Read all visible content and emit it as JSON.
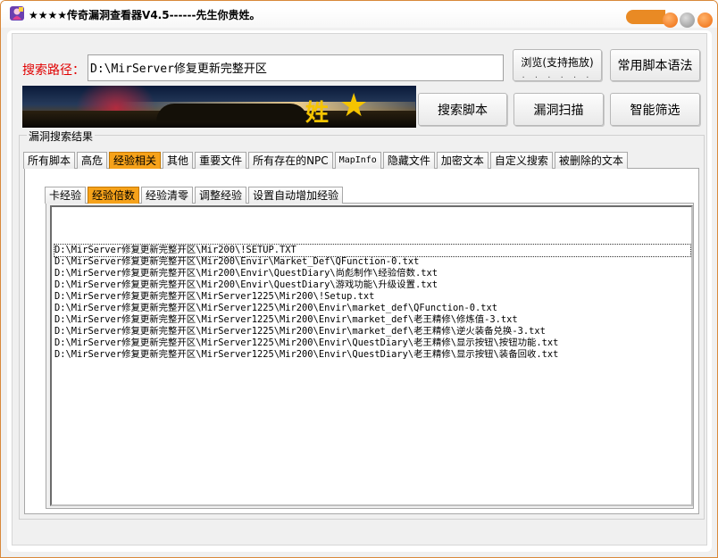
{
  "window": {
    "title": "★★★★传奇漏洞查看器V4.5------先生你贵姓。",
    "accent_color": "#f6a21a"
  },
  "search": {
    "label": "搜索路径：",
    "path": "D:\\MirServer修复更新完整开区"
  },
  "buttons": {
    "browse": "浏览(支持拖放)",
    "browse_dots": "· · · · · ·",
    "common_syntax": "常用脚本语法",
    "search_script": "搜索脚本",
    "vuln_scan": "漏洞扫描",
    "smart_filter": "智能筛选"
  },
  "banner": {
    "char": "姓"
  },
  "results_group": {
    "title": "漏洞搜索结果"
  },
  "tabs": [
    {
      "label": "所有脚本",
      "active": false
    },
    {
      "label": "高危",
      "active": false
    },
    {
      "label": "经验相关",
      "active": true
    },
    {
      "label": "其他",
      "active": false
    },
    {
      "label": "重要文件",
      "active": false
    },
    {
      "label": "所有存在的NPC",
      "active": false
    },
    {
      "label": "MapInfo",
      "active": false
    },
    {
      "label": "隐藏文件",
      "active": false
    },
    {
      "label": "加密文本",
      "active": false
    },
    {
      "label": "自定义搜索",
      "active": false
    },
    {
      "label": "被删除的文本",
      "active": false
    }
  ],
  "sub_tabs": [
    {
      "label": "卡经验",
      "active": false
    },
    {
      "label": "经验倍数",
      "active": true
    },
    {
      "label": "经验清零",
      "active": false
    },
    {
      "label": "调整经验",
      "active": false
    },
    {
      "label": "设置自动增加经验",
      "active": false
    }
  ],
  "results": [
    "D:\\MirServer修复更新完整开区\\Mir200\\!SETUP.TXT",
    "D:\\MirServer修复更新完整开区\\Mir200\\Envir\\Market_Def\\QFunction-0.txt",
    "D:\\MirServer修复更新完整开区\\Mir200\\Envir\\QuestDiary\\尚彪制作\\经验倍数.txt",
    "D:\\MirServer修复更新完整开区\\Mir200\\Envir\\QuestDiary\\游戏功能\\升级设置.txt",
    "D:\\MirServer修复更新完整开区\\MirServer1225\\Mir200\\!Setup.txt",
    "D:\\MirServer修复更新完整开区\\MirServer1225\\Mir200\\Envir\\market_def\\QFunction-0.txt",
    "D:\\MirServer修复更新完整开区\\MirServer1225\\Mir200\\Envir\\market_def\\老王精修\\修炼值-3.txt",
    "D:\\MirServer修复更新完整开区\\MirServer1225\\Mir200\\Envir\\market_def\\老王精修\\逆火装备兑换-3.txt",
    "D:\\MirServer修复更新完整开区\\MirServer1225\\Mir200\\Envir\\QuestDiary\\老王精修\\显示按钮\\按钮功能.txt",
    "D:\\MirServer修复更新完整开区\\MirServer1225\\Mir200\\Envir\\QuestDiary\\老王精修\\显示按钮\\装备回收.txt"
  ]
}
